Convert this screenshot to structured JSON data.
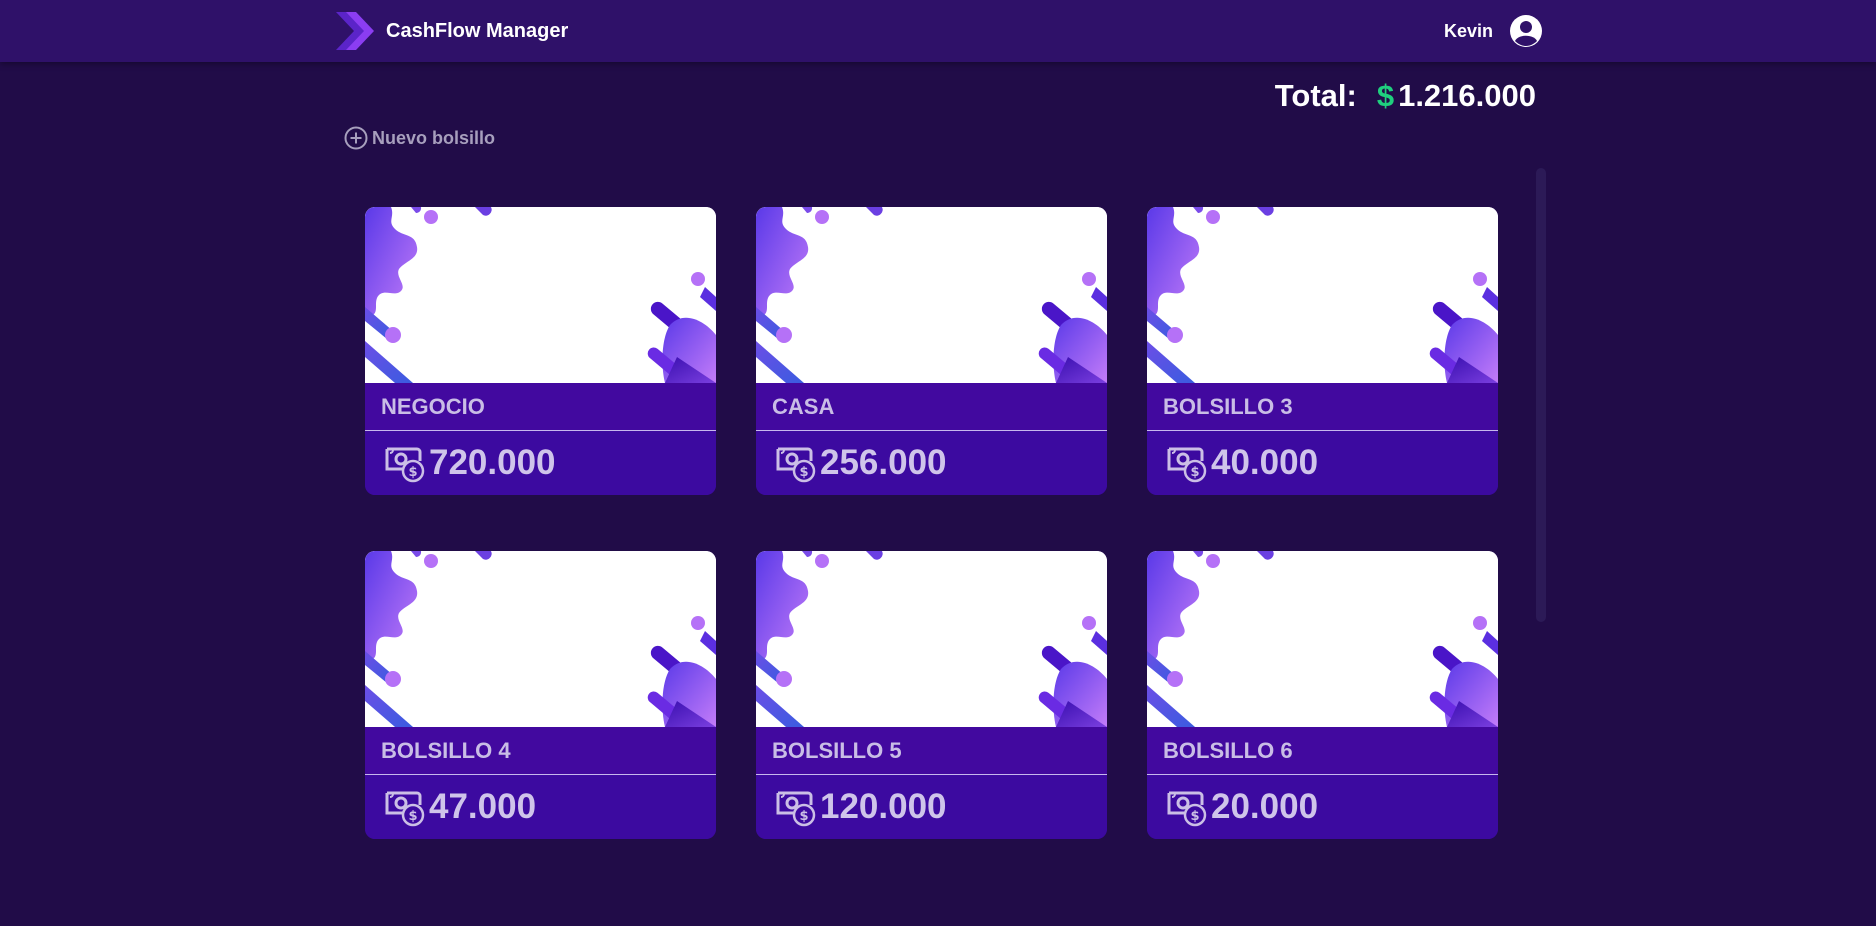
{
  "header": {
    "app_name": "CashFlow Manager",
    "user_name": "Kevin"
  },
  "summary": {
    "total_label": "Total:",
    "currency_symbol": "$",
    "total_value": "1.216.000"
  },
  "actions": {
    "new_pocket_label": "Nuevo bolsillo"
  },
  "pockets": [
    {
      "name": "NEGOCIO",
      "amount": "720.000"
    },
    {
      "name": "CASA",
      "amount": "256.000"
    },
    {
      "name": "BOLSILLO 3",
      "amount": "40.000"
    },
    {
      "name": "BOLSILLO 4",
      "amount": "47.000"
    },
    {
      "name": "BOLSILLO 5",
      "amount": "120.000"
    },
    {
      "name": "BOLSILLO 6",
      "amount": "20.000"
    }
  ],
  "icons": {
    "logo": "chevron-logo-icon",
    "user": "user-circle-icon",
    "add": "plus-circle-icon",
    "money": "money-bill-icon"
  },
  "colors": {
    "background": "#210c48",
    "topbar": "#2f1169",
    "card_band": "#42099f",
    "accent_green": "#1fcf7e",
    "accent_purple": "#8b3df2"
  }
}
